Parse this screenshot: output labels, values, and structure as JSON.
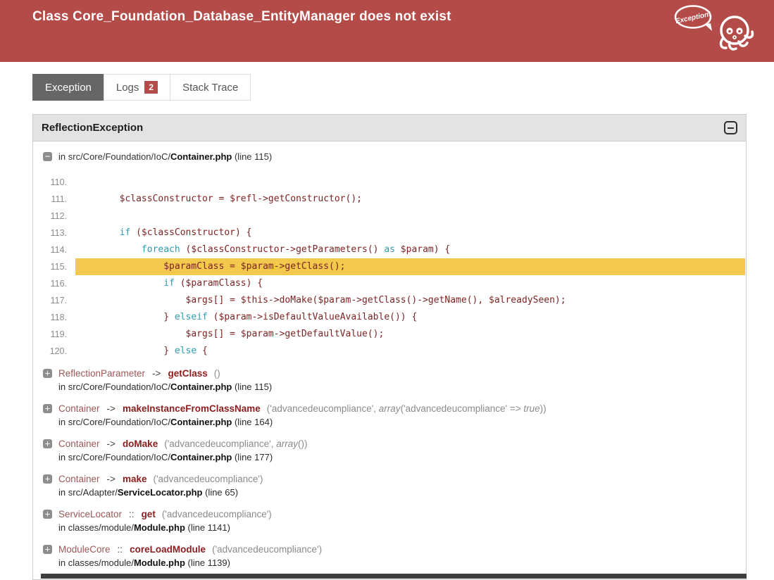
{
  "header": {
    "title": "Class Core_Foundation_Database_EntityManager does not exist",
    "logo_bubble_text": "Exception!"
  },
  "colors": {
    "header_bg": "#b34b49",
    "active_tab_bg": "#666666",
    "badge_bg": "#b34b49",
    "panel_header_bg": "#e3e3e3",
    "highlight_line_bg": "#f2c94c",
    "keyword": "#2e9bb0",
    "code_default": "#7c2323",
    "method_name": "#8b1d1d"
  },
  "tabs": [
    {
      "label": "Exception",
      "active": true
    },
    {
      "label": "Logs",
      "badge": "2",
      "active": false
    },
    {
      "label": "Stack Trace",
      "active": false
    }
  ],
  "panel": {
    "title": "ReflectionException"
  },
  "source_frame": {
    "prefix": "in ",
    "path": "src/Core/Foundation/IoC/",
    "file": "Container.php",
    "line": " (line 115)"
  },
  "code": {
    "highlight_line": "115",
    "lines": [
      {
        "no": "110.",
        "tokens": []
      },
      {
        "no": "111.",
        "tokens": [
          {
            "c": "d",
            "t": "        $classConstructor = $refl->getConstructor();"
          }
        ]
      },
      {
        "no": "112.",
        "tokens": []
      },
      {
        "no": "113.",
        "tokens": [
          {
            "c": "d",
            "t": "        "
          },
          {
            "c": "k",
            "t": "if"
          },
          {
            "c": "d",
            "t": " ($classConstructor) {"
          }
        ]
      },
      {
        "no": "114.",
        "tokens": [
          {
            "c": "d",
            "t": "            "
          },
          {
            "c": "k",
            "t": "foreach"
          },
          {
            "c": "d",
            "t": " ($classConstructor->getParameters() "
          },
          {
            "c": "k",
            "t": "as"
          },
          {
            "c": "d",
            "t": " $param) {"
          }
        ]
      },
      {
        "no": "115.",
        "hl": true,
        "tokens": [
          {
            "c": "d",
            "t": "                $paramClass = $param->getClass();"
          }
        ]
      },
      {
        "no": "116.",
        "tokens": [
          {
            "c": "d",
            "t": "                "
          },
          {
            "c": "k",
            "t": "if"
          },
          {
            "c": "d",
            "t": " ($paramClass) {"
          }
        ]
      },
      {
        "no": "117.",
        "tokens": [
          {
            "c": "d",
            "t": "                    $args[] = $this->doMake($param->getClass()->getName(), $alreadySeen);"
          }
        ]
      },
      {
        "no": "118.",
        "tokens": [
          {
            "c": "d",
            "t": "                } "
          },
          {
            "c": "k",
            "t": "elseif"
          },
          {
            "c": "d",
            "t": " ($param->isDefaultValueAvailable()) {"
          }
        ]
      },
      {
        "no": "119.",
        "tokens": [
          {
            "c": "d",
            "t": "                    $args[] = $param->getDefaultValue();"
          }
        ]
      },
      {
        "no": "120.",
        "tokens": [
          {
            "c": "d",
            "t": "                } "
          },
          {
            "c": "k",
            "t": "else"
          },
          {
            "c": "d",
            "t": " {"
          }
        ]
      }
    ]
  },
  "stack": [
    {
      "cls": "ReflectionParameter",
      "op": "->",
      "method": "getClass",
      "args": [
        {
          "c": "s",
          "t": " ()"
        }
      ],
      "loc_prefix": "in ",
      "loc_path": "src/Core/Foundation/IoC/",
      "loc_file": "Container.php",
      "loc_line": " (line 115)"
    },
    {
      "cls": "Container",
      "op": "->",
      "method": "makeInstanceFromClassName",
      "args": [
        {
          "c": "s",
          "t": " ('advancedeucompliance', "
        },
        {
          "c": "i",
          "t": "array"
        },
        {
          "c": "s",
          "t": "('advancedeucompliance' => "
        },
        {
          "c": "i",
          "t": "true"
        },
        {
          "c": "s",
          "t": "))"
        }
      ],
      "loc_prefix": "in ",
      "loc_path": "src/Core/Foundation/IoC/",
      "loc_file": "Container.php",
      "loc_line": " (line 164)"
    },
    {
      "cls": "Container",
      "op": "->",
      "method": "doMake",
      "args": [
        {
          "c": "s",
          "t": " ('advancedeucompliance', "
        },
        {
          "c": "i",
          "t": "array"
        },
        {
          "c": "s",
          "t": "())"
        }
      ],
      "loc_prefix": "in ",
      "loc_path": "src/Core/Foundation/IoC/",
      "loc_file": "Container.php",
      "loc_line": " (line 177)"
    },
    {
      "cls": "Container",
      "op": "->",
      "method": "make",
      "args": [
        {
          "c": "s",
          "t": " ('advancedeucompliance')"
        }
      ],
      "loc_prefix": "in ",
      "loc_path": "src/Adapter/",
      "loc_file": "ServiceLocator.php",
      "loc_line": " (line 65)"
    },
    {
      "cls": "ServiceLocator",
      "op": "::",
      "method": "get",
      "args": [
        {
          "c": "s",
          "t": " ('advancedeucompliance')"
        }
      ],
      "loc_prefix": "in ",
      "loc_path": "classes/module/",
      "loc_file": "Module.php",
      "loc_line": " (line 1141)"
    },
    {
      "cls": "ModuleCore",
      "op": "::",
      "method": "coreLoadModule",
      "args": [
        {
          "c": "s",
          "t": " ('advancedeucompliance')"
        }
      ],
      "loc_prefix": "in ",
      "loc_path": "classes/module/",
      "loc_file": "Module.php",
      "loc_line": " (line 1139)"
    }
  ]
}
